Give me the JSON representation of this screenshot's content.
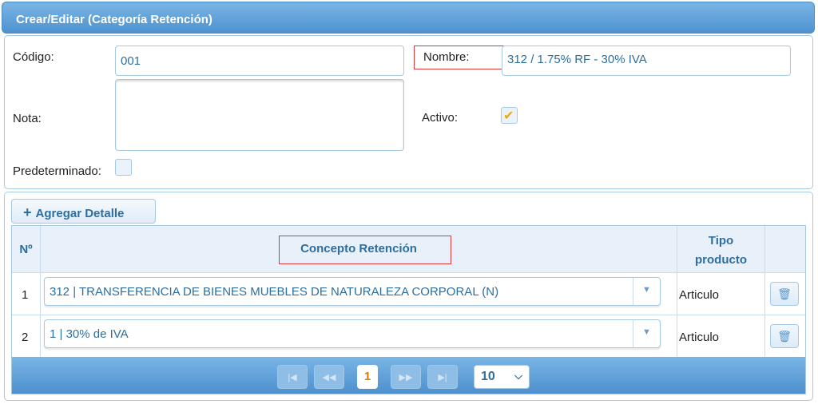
{
  "window": {
    "title": "Crear/Editar (Categoría Retención)"
  },
  "form": {
    "codigo_label": "Código:",
    "codigo_value": "001",
    "nombre_label": "Nombre:",
    "nombre_value": "312 / 1.75% RF - 30% IVA",
    "nota_label": "Nota:",
    "nota_value": "",
    "activo_label": "Activo:",
    "activo_checked": true,
    "predeterminado_label": "Predeterminado:",
    "predeterminado_checked": false
  },
  "details": {
    "add_button_label": "Agregar Detalle",
    "columns": {
      "num": "Nº",
      "concepto": "Concepto Retención",
      "tipo_line1": "Tipo",
      "tipo_line2": "producto"
    },
    "rows": [
      {
        "num": "1",
        "concepto": "312 | TRANSFERENCIA DE BIENES MUEBLES DE NATURALEZA CORPORAL (N)",
        "tipo": "Articulo"
      },
      {
        "num": "2",
        "concepto": "1 | 30% de IVA",
        "tipo": "Articulo"
      }
    ]
  },
  "pager": {
    "current_page": "1",
    "page_size": "10"
  },
  "colors": {
    "accent": "#2e6e9e",
    "header_blue": "#4e92cf",
    "highlight_red": "#d9383a",
    "check": "#f2a900"
  }
}
